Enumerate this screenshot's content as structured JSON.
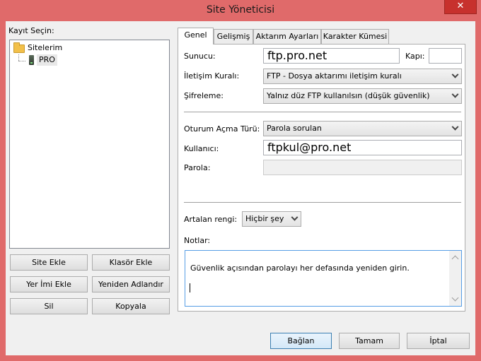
{
  "window": {
    "title": "Site Yöneticisi",
    "close_glyph": "✕"
  },
  "left": {
    "select_label": "Kayıt Seçin:",
    "tree": {
      "root": "Sitelerim",
      "child": "PRO"
    },
    "buttons": {
      "add_site": "Site Ekle",
      "add_folder": "Klasör Ekle",
      "add_bookmark": "Yer İmi Ekle",
      "rename": "Yeniden Adlandır",
      "delete": "Sil",
      "copy": "Kopyala"
    }
  },
  "tabs": [
    "Genel",
    "Gelişmiş",
    "Aktarım Ayarları",
    "Karakter Kümesi"
  ],
  "general": {
    "host_label": "Sunucu:",
    "host_value": "ftp.pro.net",
    "port_label": "Kapı:",
    "port_value": "",
    "protocol_label": "İletişim Kuralı:",
    "protocol_value": "FTP - Dosya aktarımı iletişim kuralı",
    "encryption_label": "Şifreleme:",
    "encryption_value": "Yalnız düz FTP kullanılsın (düşük güvenlik)",
    "logon_type_label": "Oturum Açma Türü:",
    "logon_type_value": "Parola sorulan",
    "user_label": "Kullanıcı:",
    "user_value": "ftpkul@pro.net",
    "password_label": "Parola:",
    "bg_color_label": "Artalan rengi:",
    "bg_color_value": "Hiçbir şey",
    "notes_label": "Notlar:",
    "notes_value": "Güvenlik açısından parolayı her defasında yeniden girin."
  },
  "footer": {
    "connect": "Bağlan",
    "ok": "Tamam",
    "cancel": "İptal"
  }
}
